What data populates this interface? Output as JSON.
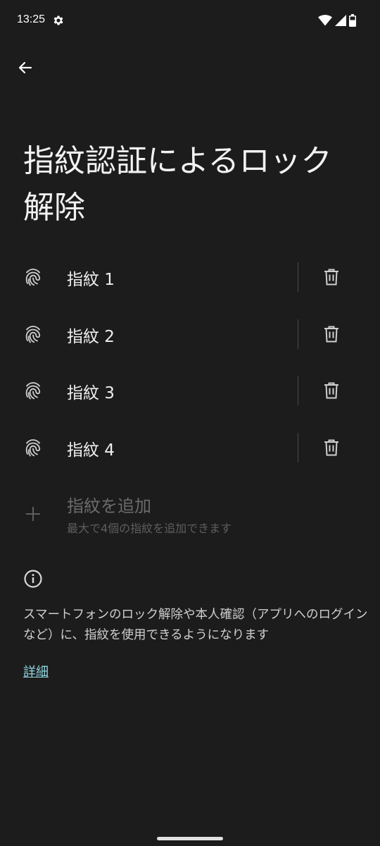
{
  "status_bar": {
    "time": "13:25",
    "icons": [
      "gear-icon",
      "wifi-icon",
      "signal-icon",
      "battery-icon"
    ]
  },
  "header": {
    "back_icon": "arrow-back-icon"
  },
  "page": {
    "title": "指紋認証によるロック解除"
  },
  "fingerprints": [
    {
      "label": "指紋 1",
      "icon": "fingerprint-icon",
      "action_icon": "trash-icon"
    },
    {
      "label": "指紋 2",
      "icon": "fingerprint-icon",
      "action_icon": "trash-icon"
    },
    {
      "label": "指紋 3",
      "icon": "fingerprint-icon",
      "action_icon": "trash-icon"
    },
    {
      "label": "指紋 4",
      "icon": "fingerprint-icon",
      "action_icon": "trash-icon"
    }
  ],
  "add_fingerprint": {
    "title": "指紋を追加",
    "subtitle": "最大で4個の指紋を追加できます",
    "icon": "plus-icon",
    "enabled": false
  },
  "info": {
    "icon": "info-icon",
    "text": "スマートフォンのロック解除や本人確認（アプリへのログインなど）に、指紋を使用できるようになります",
    "link_label": "詳細"
  },
  "colors": {
    "background": "#1c1c1c",
    "text_primary": "#f2f2f2",
    "text_disabled": "#6b6b6b",
    "link": "#8fd6e1"
  }
}
